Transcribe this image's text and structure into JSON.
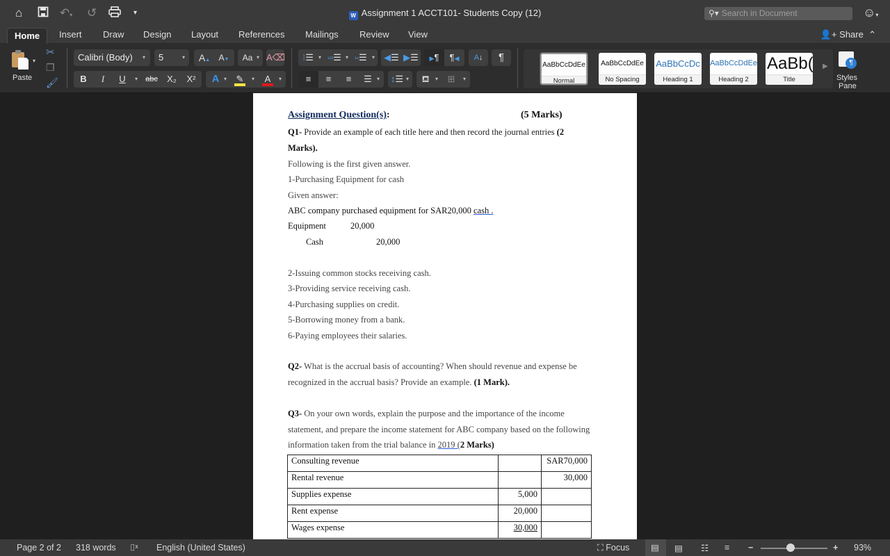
{
  "titlebar": {
    "doc_title": "Assignment 1 ACCT101- Students Copy (12)",
    "app_badge": "W",
    "search_placeholder": "Search in Document",
    "icons": [
      "home-icon",
      "save-icon",
      "undo-icon",
      "redo-icon",
      "print-icon",
      "customize-toolbar-icon",
      "smiley-feedback-icon"
    ]
  },
  "tabs": [
    {
      "label": "Home",
      "active": true
    },
    {
      "label": "Insert"
    },
    {
      "label": "Draw"
    },
    {
      "label": "Design"
    },
    {
      "label": "Layout"
    },
    {
      "label": "References"
    },
    {
      "label": "Mailings"
    },
    {
      "label": "Review"
    },
    {
      "label": "View"
    }
  ],
  "share_label": "Share",
  "ribbon": {
    "paste_label": "Paste",
    "font_name": "Calibri (Body)",
    "font_size": "5",
    "format_buttons": {
      "bold": "B",
      "italic": "I",
      "underline": "U",
      "strike": "abc",
      "subscript": "X₂",
      "superscript": "X²"
    },
    "styles": [
      {
        "sample": "AaBbCcDdEe",
        "label": "Normal",
        "selected": true
      },
      {
        "sample": "AaBbCcDdEe",
        "label": "No Spacing"
      },
      {
        "sample": "AaBbCcDc",
        "label": "Heading 1"
      },
      {
        "sample": "AaBbCcDdEe",
        "label": "Heading 2"
      },
      {
        "sample": "AaBb(",
        "label": "Title"
      }
    ],
    "styles_pane_label_1": "Styles",
    "styles_pane_label_2": "Pane",
    "colors": {
      "highlight": "#f4e542",
      "font_color": "#e0191d",
      "accent_blue": "#2f7fd4"
    }
  },
  "document": {
    "heading": "Assignment Question(s)",
    "heading_colon": ":",
    "heading_marks": "(5 Marks)",
    "q1_label": "Q1-",
    "q1_text": " Provide an example of each title here and then record the journal entries ",
    "q1_marks_a": "(2",
    "q1_marks_b": "Marks).",
    "given_intro": "Following is the first given answer.",
    "item1": "1-Purchasing Equipment for cash",
    "given_answer_label": "Given answer:",
    "example_text": "ABC company purchased equipment for SAR20,000 ",
    "example_cash": "cash .",
    "journal": {
      "debit_account": "Equipment",
      "debit_amount": "20,000",
      "credit_account": "Cash",
      "credit_amount": "20,000"
    },
    "items": [
      "2-Issuing common stocks receiving cash.",
      "3-Providing service receiving cash.",
      "4-Purchasing supplies on credit.",
      "5-Borrowing money from a bank.",
      "6-Paying employees their salaries."
    ],
    "q2_label": "Q2-",
    "q2_line1": " What is the accrual basis of accounting? When should revenue and expense be",
    "q2_line2": "recognized in the accrual basis? Provide an example. ",
    "q2_marks": "(1 Mark).",
    "q3_label": "Q3-",
    "q3_line1": " On your own words, explain the purpose and the importance of the income",
    "q3_line2": "statement, and prepare the income statement for ABC company based on the following",
    "q3_line3": "information taken from the trial balance in ",
    "q3_year": "2019  (",
    "q3_marks": "2 Marks)",
    "trial_balance": [
      {
        "account": "Consulting revenue",
        "debit": "",
        "credit": "SAR70,000"
      },
      {
        "account": "Rental revenue",
        "debit": "",
        "credit": "30,000"
      },
      {
        "account": "Supplies expense",
        "debit": "5,000",
        "credit": ""
      },
      {
        "account": "Rent expense",
        "debit": "20,000",
        "credit": ""
      },
      {
        "account": "Wages expense",
        "debit": "30,000",
        "credit": ""
      }
    ]
  },
  "statusbar": {
    "page": "Page 2 of 2",
    "words": "318 words",
    "language": "English (United States)",
    "focus_label": "Focus",
    "zoom_percent": "93%",
    "zoom_slider_fraction": 0.45
  }
}
